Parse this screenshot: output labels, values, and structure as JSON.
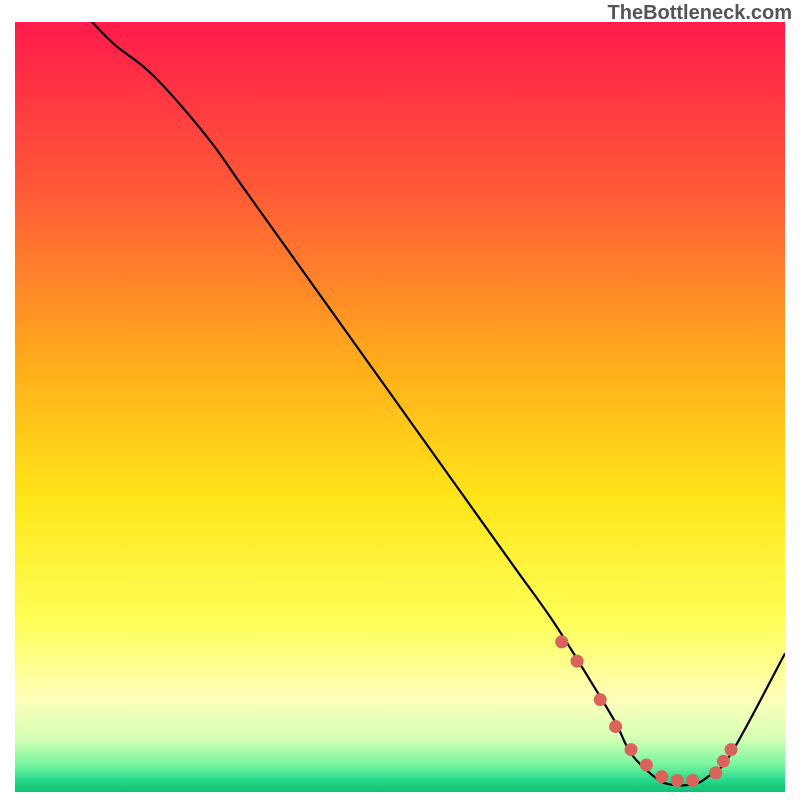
{
  "watermark": "TheBottleneck.com",
  "chart_data": {
    "type": "line",
    "title": "",
    "xlabel": "",
    "ylabel": "",
    "xlim": [
      0,
      100
    ],
    "ylim": [
      0,
      100
    ],
    "grid": false,
    "series": [
      {
        "name": "curve",
        "x": [
          10,
          13,
          18,
          25,
          30,
          40,
          50,
          60,
          65,
          70,
          75,
          78,
          80,
          83,
          85,
          88,
          90,
          93,
          100
        ],
        "values": [
          100,
          97,
          93,
          85,
          78,
          64,
          50,
          36,
          29,
          22,
          14,
          9,
          5,
          2,
          1,
          1,
          2,
          5,
          18
        ]
      }
    ],
    "markers": {
      "name": "points",
      "x": [
        71,
        73,
        76,
        78,
        80,
        82,
        84,
        86,
        88,
        91,
        92,
        93
      ],
      "values": [
        19.5,
        17,
        12,
        8.5,
        5.5,
        3.5,
        2,
        1.5,
        1.5,
        2.5,
        4,
        5.5
      ],
      "color": "#d9645c",
      "radius": 6.5
    },
    "gradient_stops": [
      {
        "offset": 0,
        "color": "#ff1b4b"
      },
      {
        "offset": 0.22,
        "color": "#ff5a37"
      },
      {
        "offset": 0.45,
        "color": "#ffae1b"
      },
      {
        "offset": 0.62,
        "color": "#ffe61a"
      },
      {
        "offset": 0.78,
        "color": "#ffff59"
      },
      {
        "offset": 0.88,
        "color": "#fdffba"
      },
      {
        "offset": 0.93,
        "color": "#d6ffb5"
      },
      {
        "offset": 0.965,
        "color": "#77f59f"
      },
      {
        "offset": 0.985,
        "color": "#27d88a"
      },
      {
        "offset": 1.0,
        "color": "#0fbf74"
      }
    ]
  }
}
